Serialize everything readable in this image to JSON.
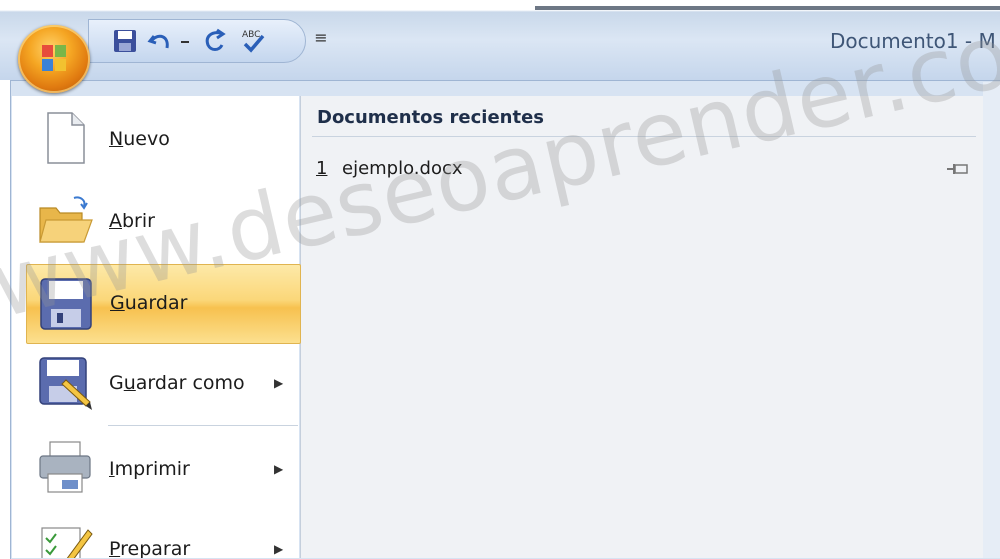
{
  "window": {
    "title": "Documento1 - M"
  },
  "quick_access": {
    "icons": [
      "save-icon",
      "undo-icon",
      "redo-icon",
      "spelling-icon"
    ],
    "more_label": "≡"
  },
  "menu": {
    "items": [
      {
        "label": "Nuevo",
        "accel": "N",
        "rest": "uevo",
        "icon": "new-document-icon",
        "submenu": false
      },
      {
        "label": "Abrir",
        "accel": "A",
        "rest": "brir",
        "icon": "open-folder-icon",
        "submenu": false
      },
      {
        "label": "Guardar",
        "accel": "G",
        "rest": "uardar",
        "icon": "save-icon",
        "submenu": false,
        "highlighted": true
      },
      {
        "label": "Guardar como",
        "pre": "G",
        "accel": "u",
        "rest": "ardar como",
        "icon": "save-as-icon",
        "submenu": true
      },
      {
        "label": "Imprimir",
        "accel": "I",
        "rest": "mprimir",
        "icon": "printer-icon",
        "submenu": true
      },
      {
        "label": "Preparar",
        "accel": "P",
        "rest": "reparar",
        "icon": "prepare-icon",
        "submenu": true
      }
    ],
    "submenu_arrow": "▶"
  },
  "recent": {
    "header": "Documentos recientes",
    "items": [
      {
        "number": "1",
        "name": "ejemplo.docx",
        "pinned": false
      }
    ]
  },
  "watermark": "www.deseoaprender.com",
  "colors": {
    "office_button": "#f5a623",
    "highlight": "#fbd779",
    "header_text": "#1f2f4a"
  }
}
